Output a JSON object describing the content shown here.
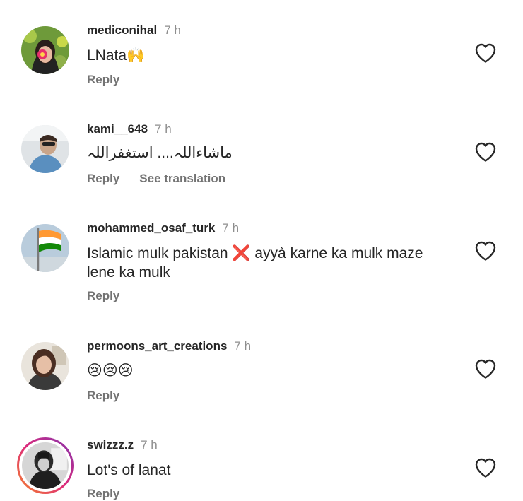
{
  "comments": [
    {
      "username": "mediconihal",
      "time": "7 h",
      "text": "LNata🙌",
      "reply_label": "Reply",
      "like_icon": "heart-outline-icon"
    },
    {
      "username": "kami__648",
      "time": "7 h",
      "text": "ماشاءاللہ.... استغفراللہ",
      "reply_label": "Reply",
      "translate_label": "See translation",
      "like_icon": "heart-outline-icon"
    },
    {
      "username": "mohammed_osaf_turk",
      "time": "7 h",
      "text_line1": "Islamic mulk pakistan ❌ ayyà karne ka mulk maze",
      "text_line2": "lene ka mulk",
      "reply_label": "Reply",
      "like_icon": "heart-outline-icon"
    },
    {
      "username": "permoons_art_creations",
      "time": "7 h",
      "text": "😢😢😢",
      "reply_label": "Reply",
      "like_icon": "heart-outline-icon"
    },
    {
      "username": "swizzz.z",
      "time": "7 h",
      "text": "Lot's of lanat",
      "reply_label": "Reply",
      "like_icon": "heart-outline-icon",
      "story_ring": true
    }
  ],
  "colors": {
    "text": "#262626",
    "muted": "#737373",
    "time": "#8e8e8e",
    "story_ring_start": "#f58529",
    "story_ring_end": "#8134af",
    "cross_red": "#dd2e44"
  }
}
